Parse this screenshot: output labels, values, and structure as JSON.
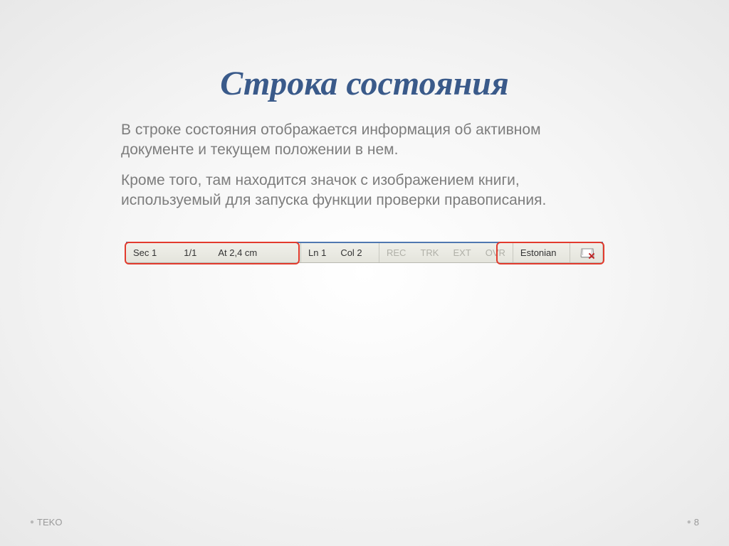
{
  "title": "Строка состояния",
  "paragraphs": {
    "p1": "В строке состояния отображается информация об активном документе и текущем положении в нем.",
    "p2": "Кроме того, там находится значок с изображением книги, используемый для запуска функции проверки правописания."
  },
  "statusbar": {
    "sec": "Sec 1",
    "page": "1/1",
    "at": "At 2,4 cm",
    "ln": "Ln 1",
    "col": "Col 2",
    "rec": "REC",
    "trk": "TRK",
    "ext": "EXT",
    "ovr": "OVR",
    "lang": "Estonian"
  },
  "footer": {
    "left": "TEKO",
    "page_number": "8"
  }
}
